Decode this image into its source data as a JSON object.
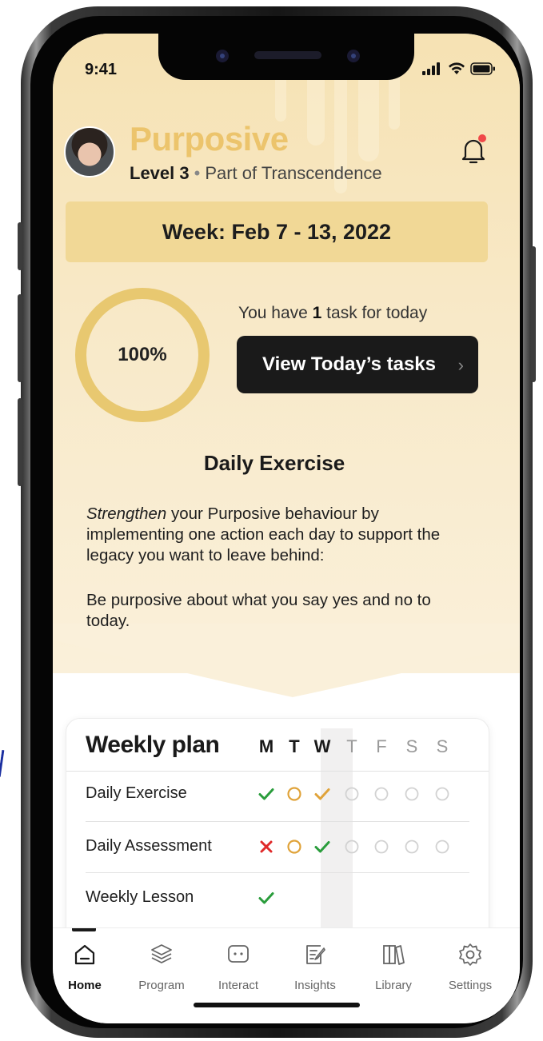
{
  "status_bar": {
    "time": "9:41"
  },
  "header": {
    "app_title": "Purposive",
    "level": "Level 3",
    "separator": "•",
    "part_of": "Part of Transcendence"
  },
  "week": {
    "label": "Week: Feb 7 - 13, 2022"
  },
  "progress": {
    "percent_label": "100%",
    "percent_value": 100,
    "tasks_prefix": "You have ",
    "tasks_count": "1",
    "tasks_suffix": " task for today",
    "button_label": "View Today’s tasks",
    "button_chevron": "›"
  },
  "exercise": {
    "title": "Daily Exercise",
    "para1_em": "Strengthen",
    "para1_rest": " your Purposive behaviour by implementing one action each day to support the legacy you want to leave behind:",
    "para2": "Be purposive about what you say yes and no to today."
  },
  "weekly_plan": {
    "title": "Weekly plan",
    "days": [
      "M",
      "T",
      "W",
      "T",
      "F",
      "S",
      "S"
    ],
    "rows": [
      {
        "label": "Daily Exercise",
        "status": [
          "done",
          "pending",
          "done-orange",
          "empty",
          "empty",
          "empty",
          "empty"
        ]
      },
      {
        "label": "Daily Assessment",
        "status": [
          "missed",
          "pending",
          "done",
          "empty",
          "empty",
          "empty",
          "empty"
        ]
      },
      {
        "label": "Weekly Lesson",
        "status": [
          "done",
          "none",
          "none",
          "none",
          "none",
          "none",
          "none"
        ]
      }
    ]
  },
  "nav": {
    "items": [
      {
        "label": "Home",
        "icon": "home-icon",
        "active": true
      },
      {
        "label": "Program",
        "icon": "layers-icon",
        "active": false
      },
      {
        "label": "Interact",
        "icon": "chat-icon",
        "active": false
      },
      {
        "label": "Insights",
        "icon": "notes-icon",
        "active": false
      },
      {
        "label": "Library",
        "icon": "books-icon",
        "active": false
      },
      {
        "label": "Settings",
        "icon": "gear-icon",
        "active": false
      }
    ]
  },
  "colors": {
    "accent_gold": "#ecc46c",
    "week_band": "#f1d896",
    "ring": "#e8c870",
    "check_green": "#2a9d3c",
    "check_orange": "#e0a33a",
    "missed_red": "#e02b2b"
  }
}
